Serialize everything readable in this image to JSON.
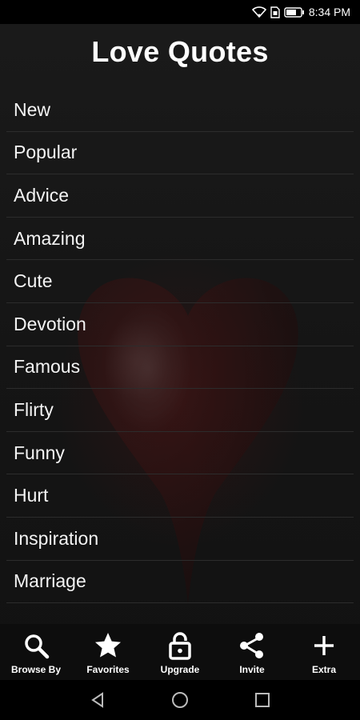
{
  "status_bar": {
    "time": "8:34 PM",
    "icons": [
      "wifi-icon",
      "sim-icon",
      "battery-icon"
    ]
  },
  "header": {
    "title": "Love Quotes"
  },
  "categories": [
    {
      "label": "New"
    },
    {
      "label": "Popular"
    },
    {
      "label": "Advice"
    },
    {
      "label": "Amazing"
    },
    {
      "label": "Cute"
    },
    {
      "label": "Devotion"
    },
    {
      "label": "Famous"
    },
    {
      "label": "Flirty"
    },
    {
      "label": "Funny"
    },
    {
      "label": "Hurt"
    },
    {
      "label": "Inspiration"
    },
    {
      "label": "Marriage"
    }
  ],
  "bottom_nav": {
    "items": [
      {
        "label": "Browse By",
        "icon": "search-icon"
      },
      {
        "label": "Favorites",
        "icon": "star-icon"
      },
      {
        "label": "Upgrade",
        "icon": "lock-icon"
      },
      {
        "label": "Invite",
        "icon": "share-icon"
      },
      {
        "label": "Extra",
        "icon": "plus-icon"
      }
    ]
  },
  "system_nav": {
    "buttons": [
      "back-icon",
      "home-icon",
      "recents-icon"
    ]
  },
  "colors": {
    "background": "#131313",
    "text": "#ffffff",
    "divider": "#2c2c2c",
    "heart": "#3a1010"
  }
}
